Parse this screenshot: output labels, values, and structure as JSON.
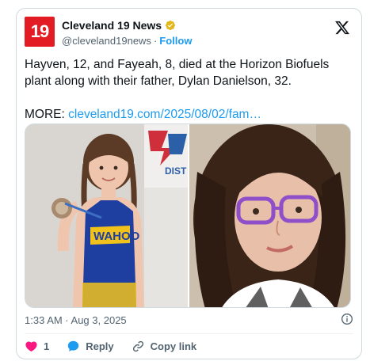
{
  "account": {
    "logo_text": "19",
    "display_name": "Cleveland 19 News",
    "handle": "@cleveland19news",
    "separator": "·",
    "follow_label": "Follow"
  },
  "tweet": {
    "text_line1": "Hayven, 12, and Fayeah, 8, died at the Horizon Biofuels plant along with their father, Dylan Danielson, 32.",
    "more_label": "MORE: ",
    "link_text": "cleveland19.com/2025/08/02/fam…",
    "timestamp": "1:33 AM · Aug 3, 2025",
    "singlet_text": "WAHOO",
    "banner_text": "DIST"
  },
  "actions": {
    "like_count": "1",
    "reply_label": "Reply",
    "copy_link_label": "Copy link"
  },
  "colors": {
    "brand_red": "#e31b23",
    "link_blue": "#1d9bf0",
    "like_pink": "#f91880",
    "muted": "#536471",
    "border": "#cfd9de"
  },
  "icons": {
    "verified": "verified-badge-icon",
    "x": "x-logo-icon",
    "info": "info-icon",
    "like": "heart-icon",
    "reply": "reply-bubble-icon",
    "copy": "link-icon"
  }
}
